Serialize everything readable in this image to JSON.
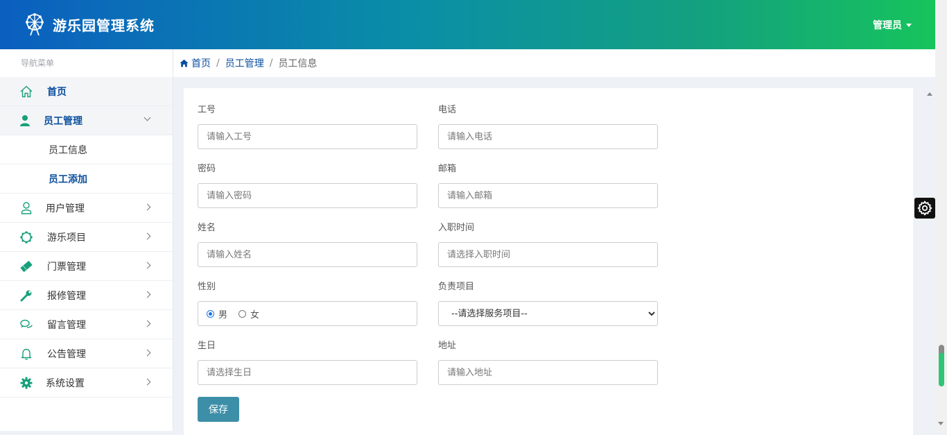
{
  "header": {
    "title": "游乐园管理系统",
    "user": "管理员"
  },
  "sidebar": {
    "title": "导航菜单",
    "items": [
      {
        "label": "首页",
        "icon": "home-icon"
      },
      {
        "label": "员工管理",
        "icon": "user-icon",
        "expanded": true,
        "children": [
          {
            "label": "员工信息"
          },
          {
            "label": "员工添加",
            "active": true
          }
        ]
      },
      {
        "label": "用户管理",
        "icon": "user-outline-icon"
      },
      {
        "label": "游乐项目",
        "icon": "ferris-wheel-icon"
      },
      {
        "label": "门票管理",
        "icon": "ticket-icon"
      },
      {
        "label": "报修管理",
        "icon": "wrench-icon"
      },
      {
        "label": "留言管理",
        "icon": "chat-icon"
      },
      {
        "label": "公告管理",
        "icon": "bell-icon"
      },
      {
        "label": "系统设置",
        "icon": "gear-icon"
      }
    ]
  },
  "breadcrumb": {
    "home": "首页",
    "section": "员工管理",
    "current": "员工信息"
  },
  "form": {
    "employee_id": {
      "label": "工号",
      "placeholder": "请输入工号"
    },
    "phone": {
      "label": "电话",
      "placeholder": "请输入电话"
    },
    "password": {
      "label": "密码",
      "placeholder": "请输入密码"
    },
    "email": {
      "label": "邮箱",
      "placeholder": "请输入邮箱"
    },
    "name": {
      "label": "姓名",
      "placeholder": "请输入姓名"
    },
    "hire_date": {
      "label": "入职时间",
      "placeholder": "请选择入职时间"
    },
    "gender": {
      "label": "性别",
      "options": [
        "男",
        "女"
      ],
      "selected": "男"
    },
    "project": {
      "label": "负责项目",
      "selected": "--请选择服务项目--"
    },
    "birthday": {
      "label": "生日",
      "placeholder": "请选择生日"
    },
    "address": {
      "label": "地址",
      "placeholder": "请输入地址"
    },
    "save_label": "保存"
  },
  "colors": {
    "accent": "#0b4f9e",
    "save_button": "#3d8fa8",
    "header_start": "#0b5fbf",
    "header_end": "#17c45c"
  }
}
